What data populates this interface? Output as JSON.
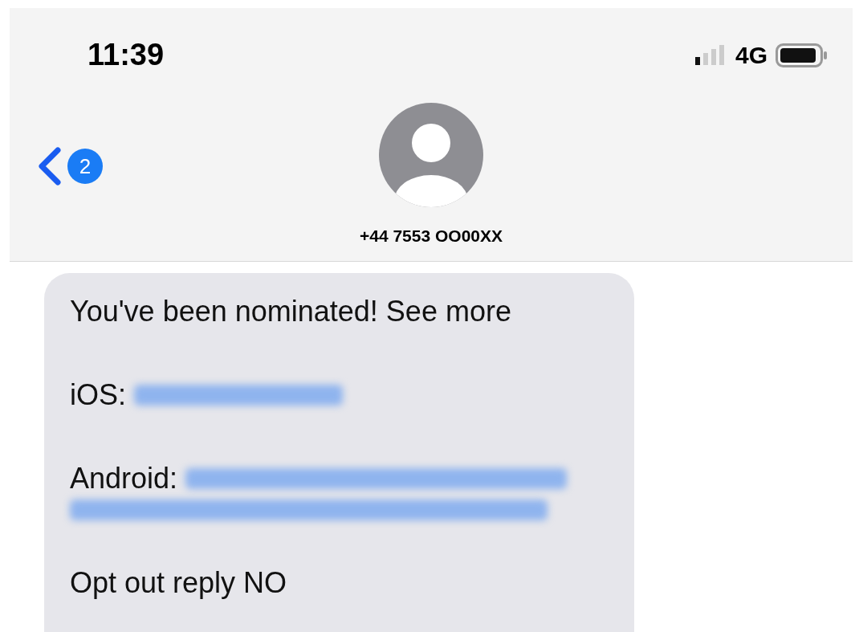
{
  "status_bar": {
    "time": "11:39",
    "network": "4G"
  },
  "header": {
    "back_badge": "2",
    "contact": "+44 7553 OO00XX"
  },
  "message": {
    "paragraphs": [
      {
        "kind": "text",
        "text": "You've been nominated! See more"
      },
      {
        "kind": "redacted-link",
        "label": "iOS:",
        "wraps": false
      },
      {
        "kind": "redacted-link",
        "label": "Android:",
        "wraps": true
      },
      {
        "kind": "text",
        "text": "Opt out reply NO"
      }
    ]
  }
}
